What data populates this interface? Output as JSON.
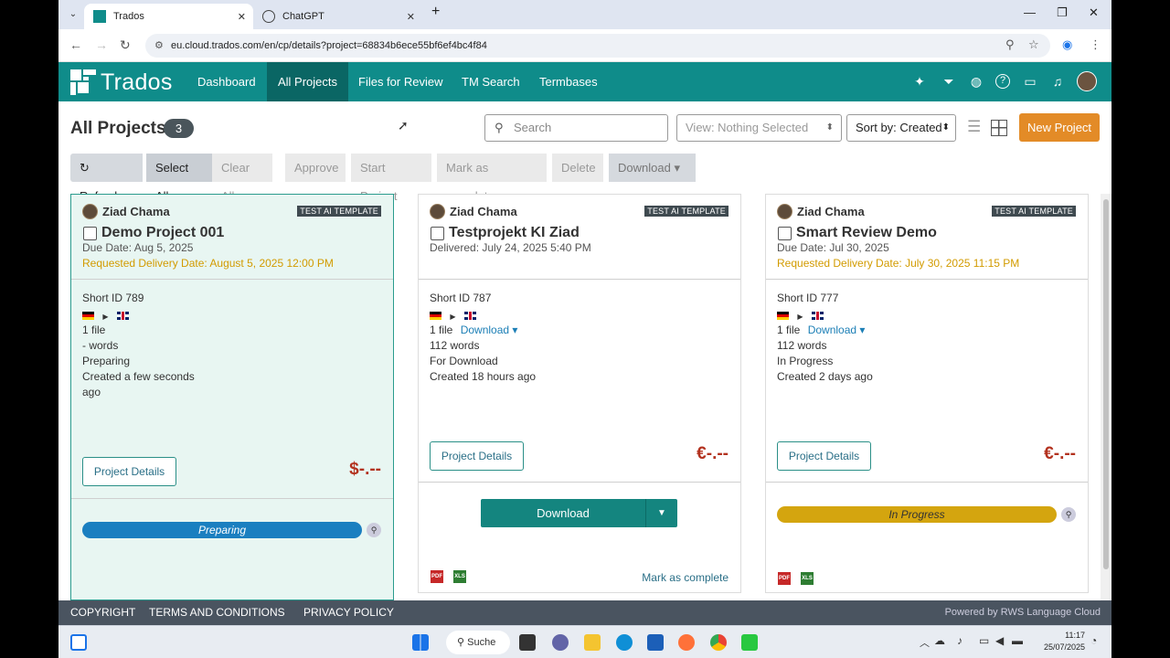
{
  "browser": {
    "tabs": [
      {
        "label": "Trados",
        "active": true
      },
      {
        "label": "ChatGPT",
        "active": false
      }
    ],
    "url": "eu.cloud.trados.com/en/cp/details?project=68834b6ece55bf6ef4bc4f84"
  },
  "header": {
    "logo": "Trados",
    "nav": [
      "Dashboard",
      "All Projects",
      "Files for Review",
      "TM Search",
      "Termbases"
    ],
    "active_nav": "All Projects",
    "icons": [
      "pin-icon",
      "filter-icon",
      "globe-icon",
      "help-icon",
      "chat-icon",
      "bell-icon",
      "avatar"
    ]
  },
  "toolbar": {
    "title": "All Projects",
    "count": "3",
    "search_placeholder": "Search",
    "view_select": "View: Nothing Selected",
    "sort_select": "Sort by: Created",
    "new_project": "New Project",
    "refresh": "Refresh",
    "select_all": "Select All",
    "clear_all": "Clear All",
    "approve": "Approve",
    "start_project": "Start Project",
    "mark_complete": "Mark as complete",
    "delete": "Delete",
    "download": "Download"
  },
  "cards": [
    {
      "owner": "Ziad Chama",
      "template": "TEST AI TEMPLATE",
      "title": "Demo Project 001",
      "due": "Due Date: Aug 5, 2025",
      "requested": "Requested Delivery Date: August 5, 2025 12:00 PM",
      "short_id": "Short ID 789",
      "files": "1 file",
      "words": "- words",
      "status": "Preparing",
      "created": "Created a few seconds",
      "created2": "ago",
      "details": "Project Details",
      "price": "$-.--",
      "progress_label": "Preparing",
      "progress_color": "#1a7fc0"
    },
    {
      "owner": "Ziad Chama",
      "template": "TEST AI TEMPLATE",
      "title": "Testprojekt KI Ziad",
      "due": "Delivered: July 24, 2025 5:40 PM",
      "short_id": "Short ID 787",
      "files": "1 file",
      "download_link": "Download",
      "words": "112 words",
      "status": "For Download",
      "created": "Created 18 hours ago",
      "details": "Project Details",
      "price": "€-.--",
      "download_button": "Download",
      "mark_complete": "Mark as complete"
    },
    {
      "owner": "Ziad Chama",
      "template": "TEST AI TEMPLATE",
      "title": "Smart Review Demo",
      "due": "Due Date: Jul 30, 2025",
      "requested": "Requested Delivery Date: July 30, 2025 11:15 PM",
      "short_id": "Short ID 777",
      "files": "1 file",
      "download_link": "Download",
      "words": "112 words",
      "status": "In Progress",
      "created": "Created 2 days ago",
      "details": "Project Details",
      "price": "€-.--",
      "progress_label": "In Progress",
      "progress_color": "#d4a50f"
    }
  ],
  "footer": {
    "copyright": "COPYRIGHT",
    "terms": "TERMS AND CONDITIONS",
    "privacy": "PRIVACY POLICY",
    "powered": "Powered by RWS Language Cloud"
  },
  "taskbar": {
    "search": "Suche",
    "time": "11:17",
    "date": "25/07/2025"
  }
}
